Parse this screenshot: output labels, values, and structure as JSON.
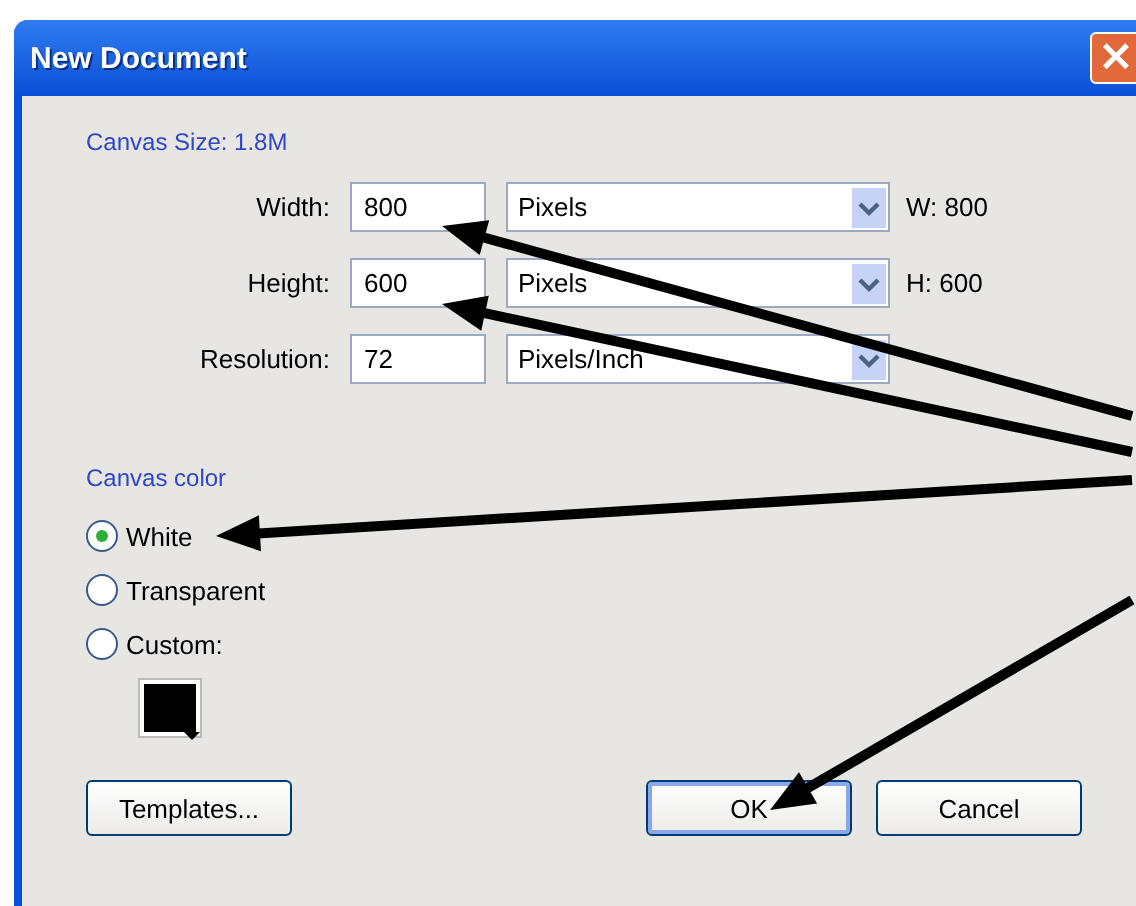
{
  "window": {
    "title": "New Document",
    "close": "×"
  },
  "canvas_size": "Canvas Size: 1.8M",
  "fields": [
    {
      "label": "Width:",
      "value": "800",
      "unit": "Pixels",
      "readout": "W: 800"
    },
    {
      "label": "Height:",
      "value": "600",
      "unit": "Pixels",
      "readout": "H: 600"
    },
    {
      "label": "Resolution:",
      "value": "72",
      "unit": "Pixels/Inch"
    }
  ],
  "canvas_color": {
    "heading": "Canvas color",
    "options": [
      {
        "label": "White",
        "selected": true
      },
      {
        "label": "Transparent",
        "selected": false
      },
      {
        "label": "Custom:",
        "selected": false
      }
    ]
  },
  "buttons": [
    {
      "label": "Templates...",
      "kind": "secondary"
    },
    {
      "label": "OK",
      "kind": "default"
    },
    {
      "label": "Cancel",
      "kind": "secondary"
    }
  ]
}
